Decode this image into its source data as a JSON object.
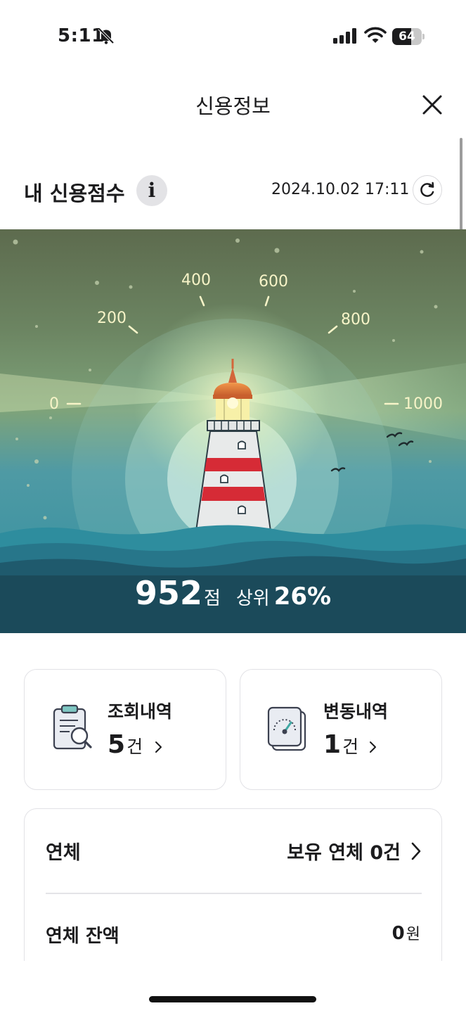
{
  "status_bar": {
    "time": "5:11",
    "battery": "64",
    "battery_level": 0.64,
    "icons": [
      "bell-slash-icon",
      "cellular-signal-icon",
      "wifi-icon",
      "battery-icon"
    ]
  },
  "header": {
    "title": "신용정보",
    "close_icon": "close-icon"
  },
  "score_section": {
    "title": "내 신용점수",
    "info_icon": "info-icon",
    "info_glyph": "i",
    "updated_at": "2024.10.02 17:11",
    "refresh_icon": "refresh-icon"
  },
  "gauge": {
    "labels": [
      "0",
      "200",
      "400",
      "600",
      "800",
      "1000"
    ],
    "min": 0,
    "max": 1000,
    "score": "952",
    "score_unit": "점",
    "rank_label": "상위",
    "rank_value": "26%"
  },
  "cards": [
    {
      "label": "조회내역",
      "count": "5",
      "unit": "건",
      "icon": "clipboard-search-icon"
    },
    {
      "label": "변동내역",
      "count": "1",
      "unit": "건",
      "icon": "gauge-document-icon"
    }
  ],
  "overdue": {
    "label": "연체",
    "value": "보유 연체 0건",
    "balance_label": "연체 잔액",
    "balance_value": "0",
    "balance_unit": "원"
  },
  "colors": {
    "sky_top": "#5e6d4f",
    "sea": "#2f93a3",
    "sea_dark": "#1b4a5a",
    "lighthouse_red": "#d62b36",
    "lamp_orange": "#e37a3c",
    "gauge_label": "#f7f4c8"
  }
}
